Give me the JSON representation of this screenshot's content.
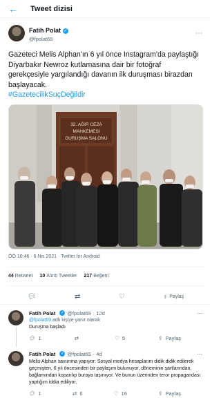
{
  "header": {
    "back_icon": "arrow-left-icon",
    "title": "Tweet dizisi"
  },
  "tweet": {
    "author_name": "Fatih Polat",
    "verified": "✓",
    "handle": "@fpolat69",
    "text": "Gazeteci Melis Alphan'ın 6 yıl önce Instagram'da paylaştığı Diyarbakır Newroz kutlamasına dair bir fotoğraf gerekçesiyle yargılandığı davanın ilk duruşması birazdan başlayacak.",
    "hashtag": "#GazetecilikSuçDeğildir",
    "photo_sign": {
      "line1": "32. AĞIR CEZA",
      "line2": "MAHKEMESİ",
      "line3": "DURUŞMA SALONU"
    },
    "timestamp": "ÖÖ 10:46 · 6 Nis 2021 · Twitter for Android",
    "stats": {
      "retweets_count": "44",
      "retweets_label": "Retweet",
      "quotes_count": "10",
      "quotes_label": "Alıntı Tweetler",
      "likes_count": "217",
      "likes_label": "Beğeni"
    },
    "share_label": "Paylaş"
  },
  "replies": [
    {
      "author_name": "Fatih Polat",
      "verified": "✓",
      "handle": "@fpolat69",
      "time": "· 12d",
      "replying_prefix": "",
      "replying_handle": "@fpolat69",
      "replying_suffix": "adlı kişiye yanıt olarak",
      "text": "Duruşma başladı",
      "reply_count": "1",
      "retweet_count": "",
      "like_count": "5",
      "share_label": "Paylaş"
    },
    {
      "author_name": "Fatih Polat",
      "verified": "✓",
      "handle": "@fpolat69",
      "time": "· 4d",
      "text": "Melis Alphan savunma yapıyor: Sosyal medya hesaplarım didik didik edilerek geçmişten, 6 yıl öncesinden bir paylaşım bulunuyor, döneminin şartlarından, bağlamından koparılıp buraya taşınıyor. Ve bunun üzerinden teror propagandası yaptığım iddia ediliyor.",
      "reply_count": "1",
      "retweet_count": "6",
      "like_count": "16",
      "share_label": "Paylaş"
    }
  ]
}
